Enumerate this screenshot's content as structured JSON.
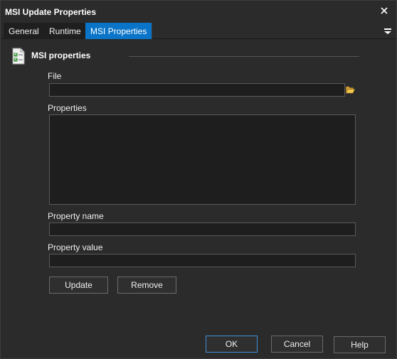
{
  "window": {
    "title": "MSI Update Properties"
  },
  "tabs": [
    {
      "label": "General"
    },
    {
      "label": "Runtime"
    },
    {
      "label": "MSI Properties"
    }
  ],
  "section": {
    "title": "MSI properties"
  },
  "fields": {
    "file_label": "File",
    "file_value": "",
    "properties_label": "Properties",
    "property_name_label": "Property name",
    "property_name_value": "",
    "property_value_label": "Property value",
    "property_value_value": ""
  },
  "actions": {
    "update_label": "Update",
    "remove_label": "Remove"
  },
  "footer": {
    "ok_label": "OK",
    "cancel_label": "Cancel",
    "help_label": "Help"
  },
  "colors": {
    "background": "#2b2b2b",
    "active_tab": "#0a74c8",
    "input_bg": "#1e1e1e"
  },
  "icons": {
    "close": "close-icon",
    "tab_menu": "menu-icon",
    "section": "checklist-document-icon",
    "browse": "folder-open-icon"
  }
}
